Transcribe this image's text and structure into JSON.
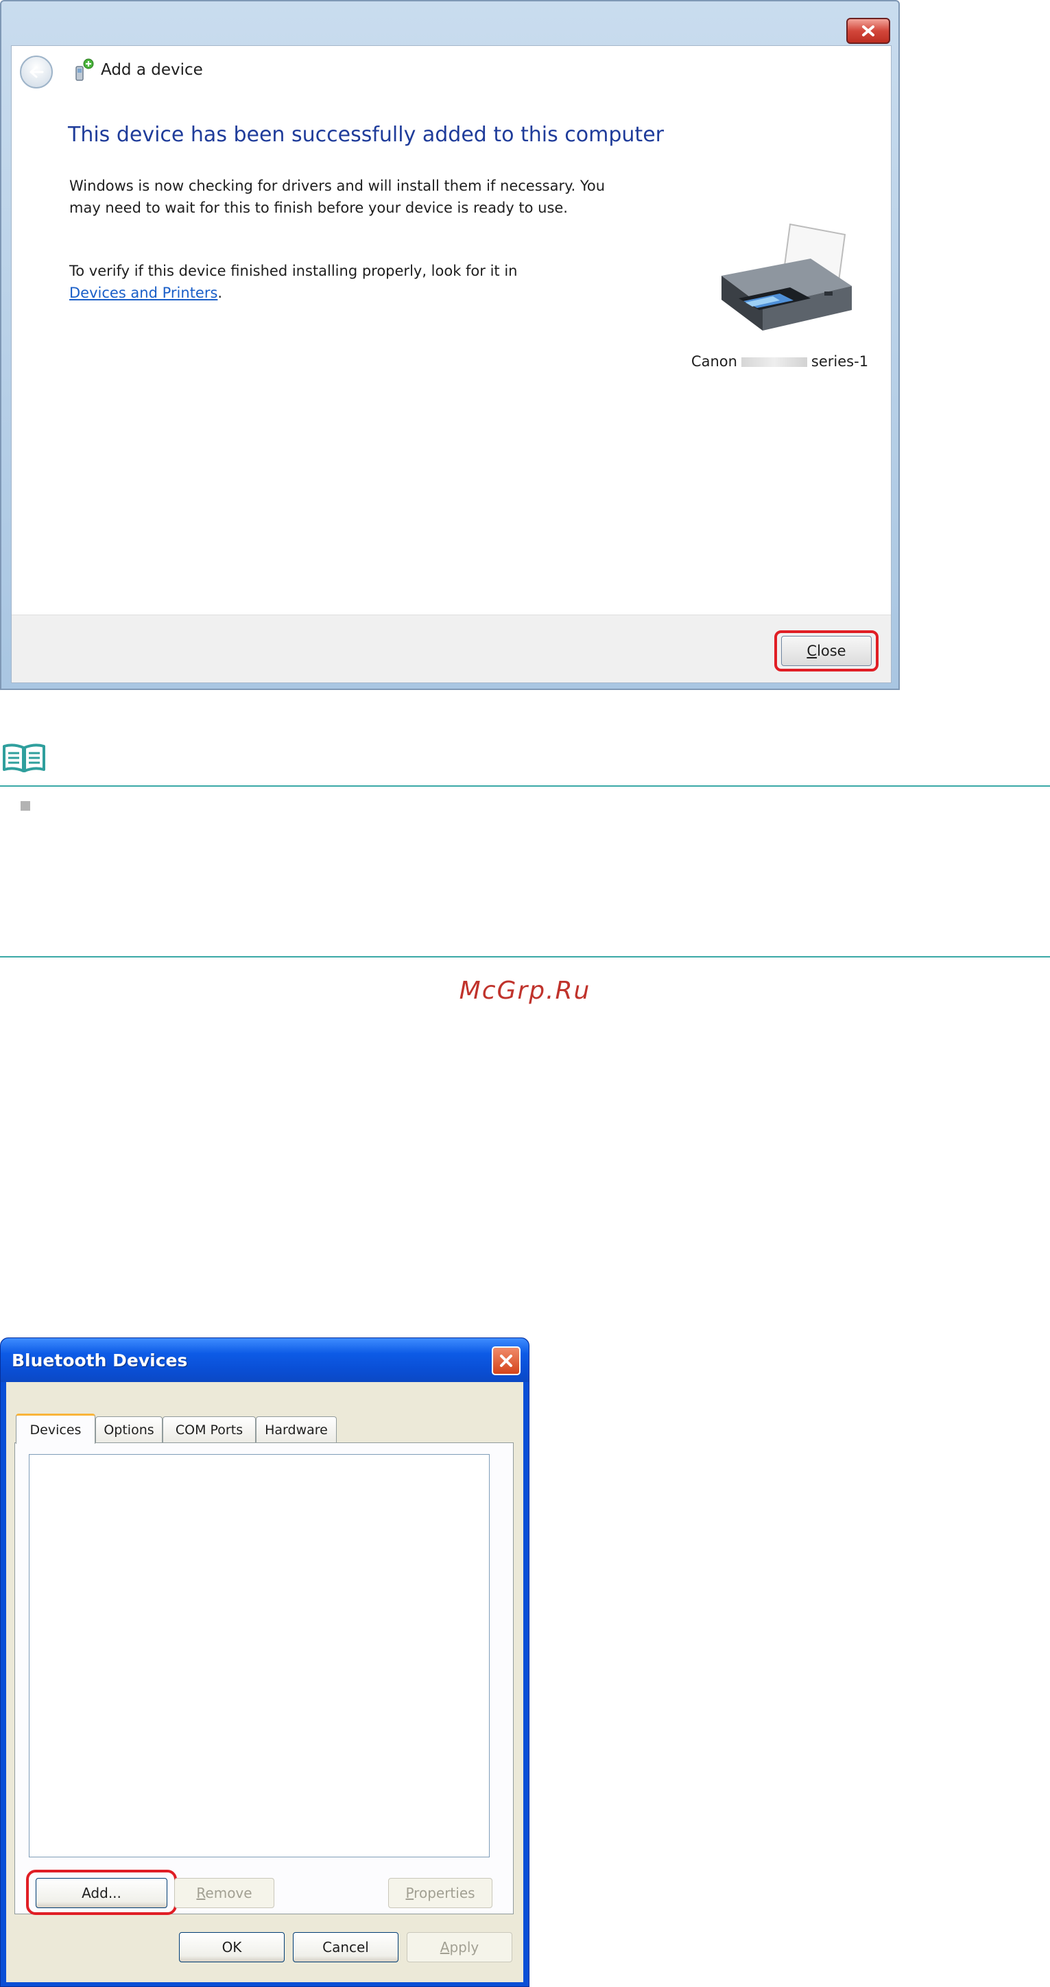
{
  "add_device_dialog": {
    "title": "Add a device",
    "heading": "This device has been successfully added to this computer",
    "paragraph1": "Windows is now checking for drivers and will install them if necessary. You may need to wait for this to finish before your device is ready to use.",
    "paragraph2_prefix": "To verify if this device finished installing properly, look for it in ",
    "devices_link": "Devices and Printers",
    "paragraph2_suffix": ".",
    "device_name_prefix": "Canon",
    "device_name_suffix": "series-1",
    "close_button": "Close",
    "icons": {
      "window_close": "close-icon",
      "back": "back-arrow-icon",
      "wizard": "add-device-icon",
      "device": "printer-icon"
    }
  },
  "note": {
    "icon": "note-book-icon",
    "accent_color": "#3aa8a6"
  },
  "watermark": "McGrp.Ru",
  "bluetooth_dialog": {
    "title": "Bluetooth Devices",
    "tabs": [
      {
        "label": "Devices",
        "active": true
      },
      {
        "label": "Options",
        "active": false
      },
      {
        "label": "COM Ports",
        "active": false
      },
      {
        "label": "Hardware",
        "active": false
      }
    ],
    "buttons": {
      "add": "Add...",
      "remove": "Remove",
      "properties": "Properties",
      "ok": "OK",
      "cancel": "Cancel",
      "apply": "Apply"
    }
  },
  "highlight_color": "#e01e25"
}
